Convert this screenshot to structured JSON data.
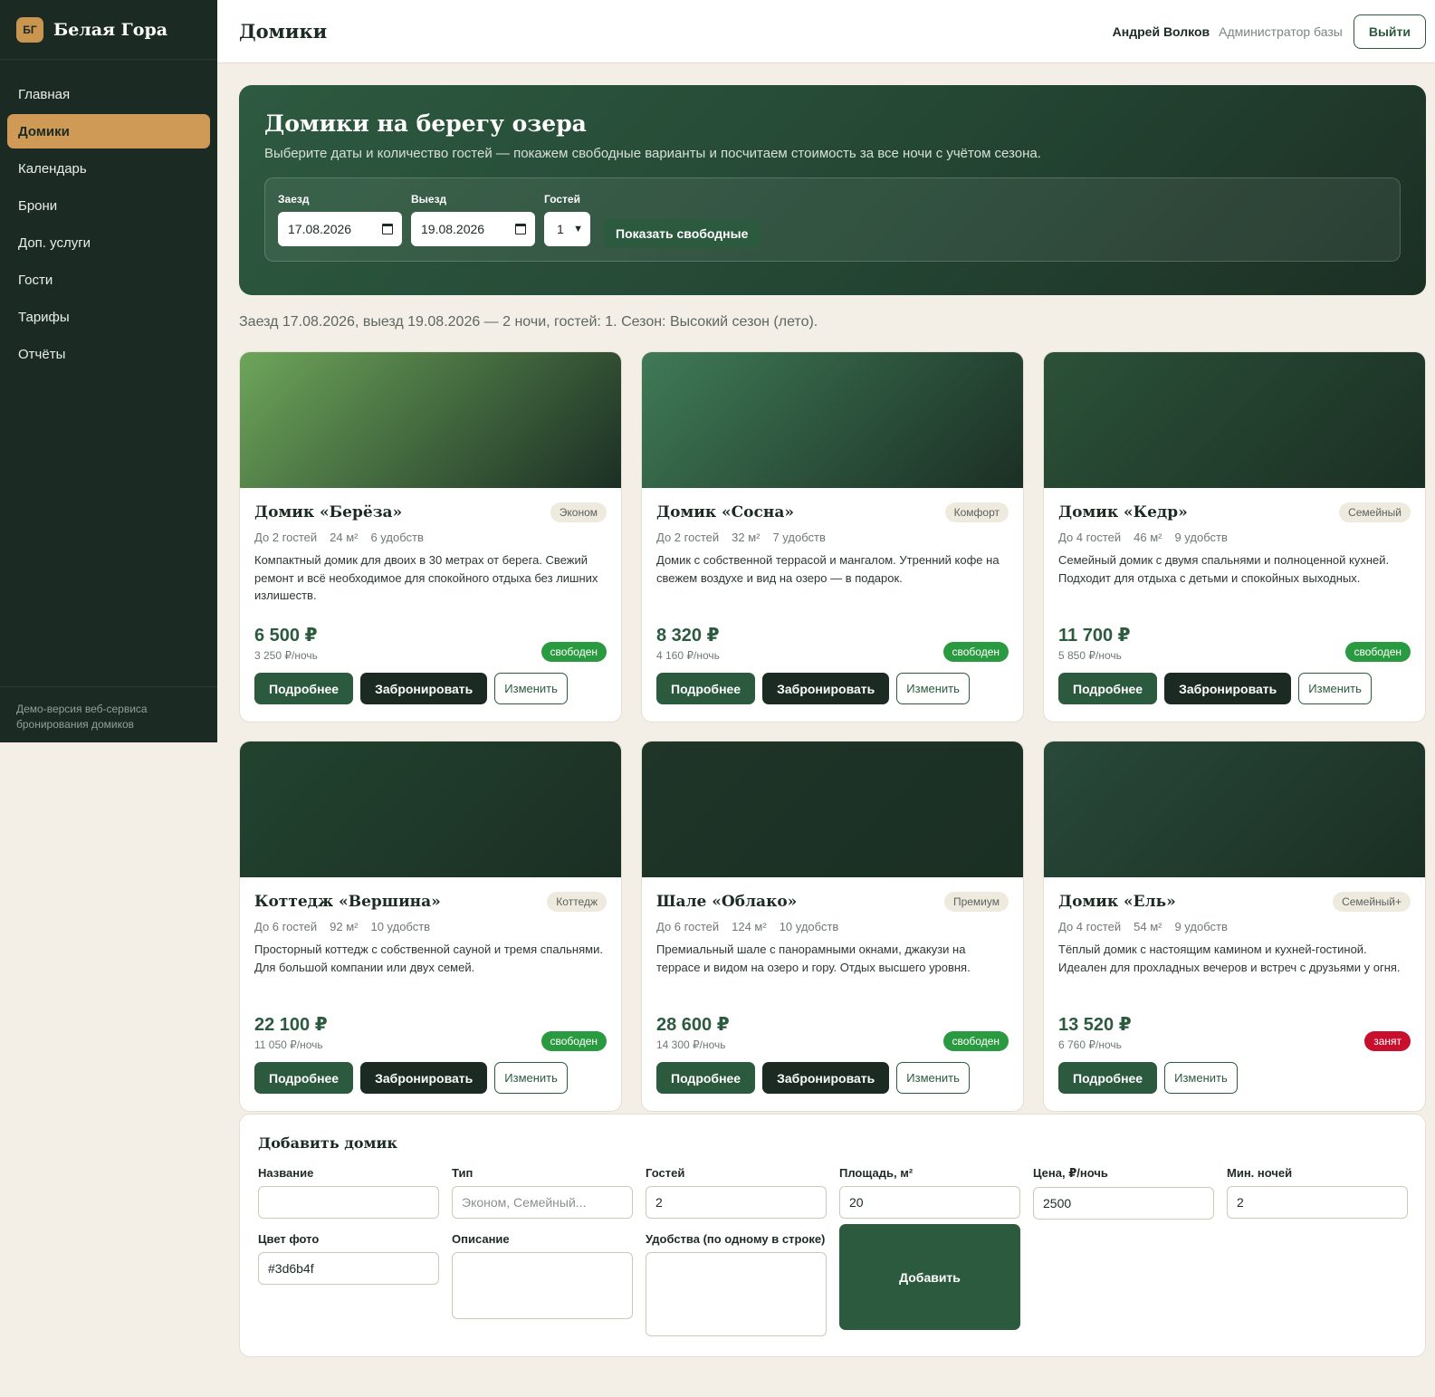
{
  "brand": {
    "mark": "БГ",
    "name": "Белая Гора"
  },
  "nav": [
    {
      "label": "Главная"
    },
    {
      "label": "Домики"
    },
    {
      "label": "Календарь"
    },
    {
      "label": "Брони"
    },
    {
      "label": "Доп. услуги"
    },
    {
      "label": "Гости"
    },
    {
      "label": "Тарифы"
    },
    {
      "label": "Отчёты"
    }
  ],
  "sidebar_footer": "Демо-версия веб-сервиса бронирования домиков",
  "header": {
    "title": "Домики",
    "user_name": "Андрей Волков",
    "user_role": "Администратор базы",
    "logout_label": "Выйти"
  },
  "hero": {
    "title": "Домики на берегу озера",
    "subtitle": "Выберите даты и количество гостей — покажем свободные варианты и посчитаем стоимость за все ночи с учётом сезона.",
    "checkin_label": "Заезд",
    "checkin_value": "17.08.2026",
    "checkout_label": "Выезд",
    "checkout_value": "19.08.2026",
    "guests_label": "Гостей",
    "guests_value": "1",
    "show_button": "Показать свободные"
  },
  "summary": "Заезд 17.08.2026, выезд 19.08.2026 — 2 ночи, гостей: 1. Сезон: Высокий сезон (лето).",
  "buttons": {
    "details": "Подробнее",
    "book": "Забронировать",
    "edit": "Изменить"
  },
  "cabins": [
    {
      "title": "Домик «Берёза»",
      "type": "Эконом",
      "guests": "До 2 гостей",
      "area": "24 м²",
      "amenities": "6 удобств",
      "description": "Компактный домик для двоих в 30 метрах от берега. Свежий ремонт и всё необходимое для спокойного отдыха без лишних излишеств.",
      "price": "6 500 ₽",
      "per_night": "3 250 ₽/ночь",
      "status": "свободен",
      "available": true,
      "photo_color": "#6da55a"
    },
    {
      "title": "Домик «Сосна»",
      "type": "Комфорт",
      "guests": "До 2 гостей",
      "area": "32 м²",
      "amenities": "7 удобств",
      "description": "Домик с собственной террасой и мангалом. Утренний кофе на свежем воздухе и вид на озеро — в подарок.",
      "price": "8 320 ₽",
      "per_night": "4 160 ₽/ночь",
      "status": "свободен",
      "available": true,
      "photo_color": "#3f7a56"
    },
    {
      "title": "Домик «Кедр»",
      "type": "Семейный",
      "guests": "До 4 гостей",
      "area": "46 м²",
      "amenities": "9 удобств",
      "description": "Семейный домик с двумя спальнями и полноценной кухней. Подходит для отдыха с детьми и спокойных выходных.",
      "price": "11 700 ₽",
      "per_night": "5 850 ₽/ночь",
      "status": "свободен",
      "available": true,
      "photo_color": "#2b5238"
    },
    {
      "title": "Коттедж «Вершина»",
      "type": "Коттедж",
      "guests": "До 6 гостей",
      "area": "92 м²",
      "amenities": "10 удобств",
      "description": "Просторный коттедж с собственной сауной и тремя спальнями. Для большой компании или двух семей.",
      "price": "22 100 ₽",
      "per_night": "11 050 ₽/ночь",
      "status": "свободен",
      "available": true,
      "photo_color": "#22432f"
    },
    {
      "title": "Шале «Облако»",
      "type": "Премиум",
      "guests": "До 6 гостей",
      "area": "124 м²",
      "amenities": "10 удобств",
      "description": "Премиальный шале с панорамными окнами, джакузи на террасе и видом на озеро и гору. Отдых высшего уровня.",
      "price": "28 600 ₽",
      "per_night": "14 300 ₽/ночь",
      "status": "свободен",
      "available": true,
      "photo_color": "#1e3528"
    },
    {
      "title": "Домик «Ель»",
      "type": "Семейный+",
      "guests": "До 4 гостей",
      "area": "54 м²",
      "amenities": "9 удобств",
      "description": "Тёплый домик с настоящим камином и кухней-гостиной. Идеален для прохладных вечеров и встреч с друзьями у огня.",
      "price": "13 520 ₽",
      "per_night": "6 760 ₽/ночь",
      "status": "занят",
      "available": false,
      "photo_color": "#28493a"
    }
  ],
  "add_form": {
    "title": "Добавить домик",
    "name_label": "Название",
    "name_value": "",
    "type_label": "Тип",
    "type_placeholder": "Эконом, Семейный...",
    "guests_label": "Гостей",
    "guests_value": "2",
    "area_label": "Площадь, м²",
    "area_value": "20",
    "price_label": "Цена, ₽/ночь",
    "price_value": "2500",
    "min_nights_label": "Мин. ночей",
    "min_nights_value": "2",
    "color_label": "Цвет фото",
    "color_value": "#3d6b4f",
    "description_label": "Описание",
    "amenities_label": "Удобства (по одному в строке)",
    "submit_label": "Добавить"
  },
  "colors": {
    "sidebar": "#1b2b23",
    "accent": "#cf9a55",
    "primary": "#2c5a3e",
    "free": "#2a9a40",
    "busy": "#c8102e",
    "background": "#f3efe6"
  }
}
